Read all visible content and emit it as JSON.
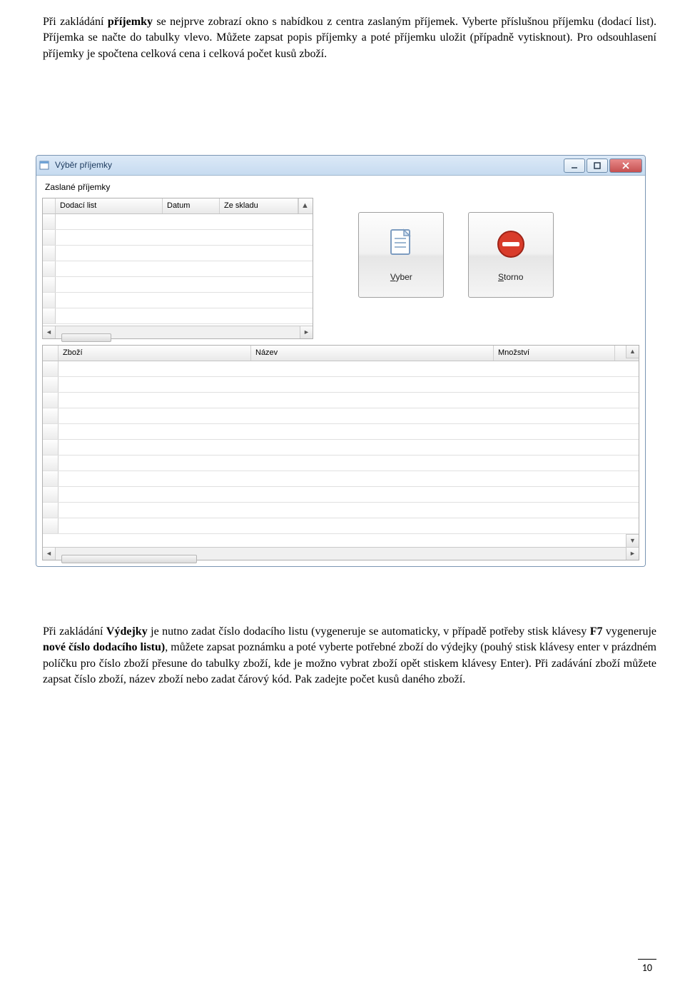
{
  "paragraphs": {
    "p1_a": "Při zakládání ",
    "p1_b": "příjemky",
    "p1_c": " se nejprve zobrazí okno s nabídkou z centra zaslaným příjemek. Vyberte příslušnou příjemku (dodací list). Příjemka se načte do tabulky vlevo. Můžete zapsat popis příjemky a poté příjemku uložit (případně vytisknout). Pro odsouhlasení příjemky je spočtena celková cena i celková počet kusů zboží.",
    "p2_a": "Při zakládání ",
    "p2_b": "Výdejky",
    "p2_c": " je nutno zadat číslo dodacího listu (vygeneruje se automaticky, v případě potřeby stisk klávesy ",
    "p2_d": "F7",
    "p2_e": " vygeneruje ",
    "p2_f": "nové číslo dodacího listu)",
    "p2_g": ", můžete zapsat poznámku a poté vyberte potřebné zboží do výdejky (pouhý stisk klávesy enter v prázdném políčku pro číslo zboží přesune do tabulky zboží, kde je možno vybrat zboží opět stiskem klávesy Enter). Při zadávání zboží můžete zapsat číslo zboží, název zboží nebo zadat čárový kód. Pak zadejte počet kusů daného zboží."
  },
  "window": {
    "title": "Výběr příjemky",
    "label_sent": "Zaslané příjemky",
    "grid1": {
      "cols": [
        "Dodací list",
        "Datum",
        "Ze skladu"
      ]
    },
    "grid2": {
      "cols": [
        "Zboží",
        "Název",
        "Množství"
      ]
    },
    "buttons": {
      "select_prefix": "V",
      "select_rest": "yber",
      "cancel_prefix": "S",
      "cancel_rest": "torno"
    }
  },
  "page_number": "10"
}
